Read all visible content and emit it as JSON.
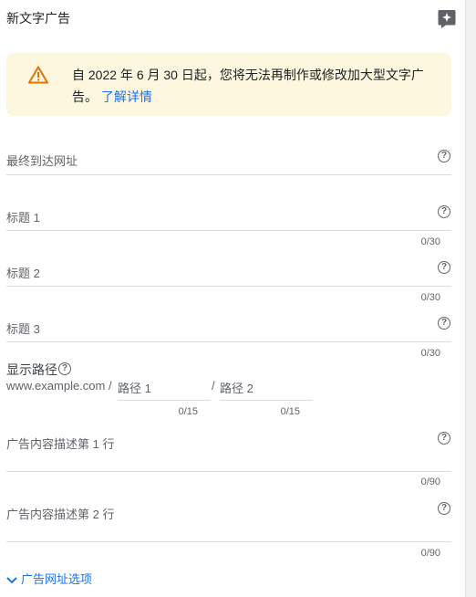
{
  "header": {
    "title": "新文字广告",
    "assist_icon": "sparkle-icon"
  },
  "warning": {
    "icon": "warning-icon",
    "text": "自 2022 年 6 月 30 日起，您将无法再制作或修改加大型文字广告。",
    "link": "了解详情",
    "color": "#fef7e0"
  },
  "fields": {
    "final_url": {
      "label": "最终到达网址"
    },
    "headline1": {
      "label": "标题 1",
      "counter": "0/30"
    },
    "headline2": {
      "label": "标题 2",
      "counter": "0/30"
    },
    "headline3": {
      "label": "标题 3",
      "counter": "0/30"
    },
    "display_path": {
      "label": "显示路径",
      "domain": "www.example.com /",
      "path1_placeholder": "路径 1",
      "separator": "/",
      "path2_placeholder": "路径 2",
      "path1_counter": "0/15",
      "path2_counter": "0/15"
    },
    "description1": {
      "label": "广告内容描述第 1 行",
      "counter": "0/90"
    },
    "description2": {
      "label": "广告内容描述第 2 行",
      "counter": "0/90"
    }
  },
  "url_options": {
    "label": "广告网址选项",
    "icon": "chevron-down-icon"
  },
  "colors": {
    "accent": "#1a73e8",
    "warning_icon": "#c5221f"
  }
}
